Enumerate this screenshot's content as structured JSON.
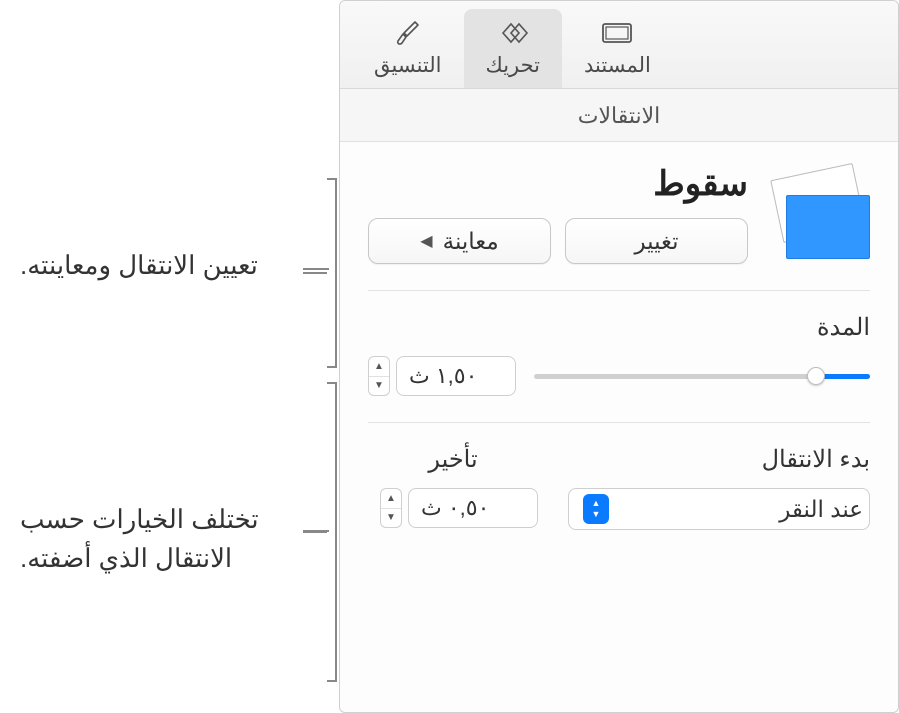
{
  "tabs": {
    "format": "التنسيق",
    "animate": "تحريك",
    "document": "المستند"
  },
  "section_title": "الانتقالات",
  "transition": {
    "name": "سقوط",
    "change_label": "تغيير",
    "preview_label": "معاينة"
  },
  "duration": {
    "label": "المدة",
    "value": "١,٥٠ ث"
  },
  "start": {
    "label": "بدء الانتقال",
    "selected": "عند النقر"
  },
  "delay": {
    "label": "تأخير",
    "value": "٠,٥٠ ث"
  },
  "callouts": {
    "c1": "تعيين الانتقال ومعاينته.",
    "c2": "تختلف الخيارات حسب الانتقال الذي أضفته."
  }
}
